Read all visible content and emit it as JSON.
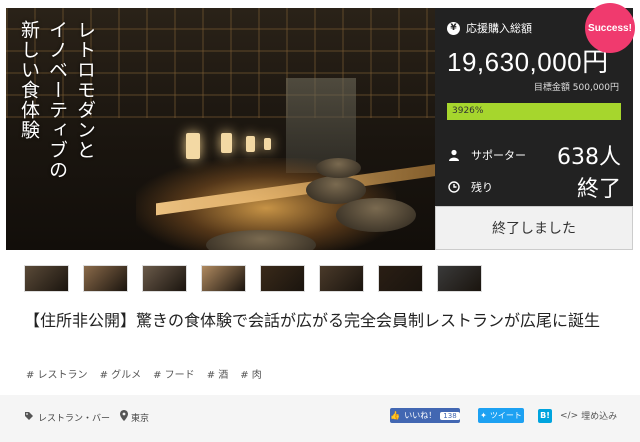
{
  "hero": {
    "tagline": [
      "レトロモダンと",
      "イノベーティブの",
      "新しい食体験"
    ]
  },
  "panel": {
    "yen_icon": "¥",
    "total_label": "応援購入総額",
    "total_value": "19,630,000円",
    "goal_label": "目標金額",
    "goal_value": "500,000円",
    "progress_text": "3926%",
    "progress_fraction": 1.0,
    "supporters_label": "サポーター",
    "supporters_value": "638人",
    "remaining_label": "残り",
    "remaining_value": "終了",
    "end_button": "終了しました",
    "badge": "Success!",
    "accent_color": "#a6d62d",
    "badge_color": "#f03a6e",
    "icons": [
      "yen-icon",
      "person-icon",
      "clock-icon"
    ]
  },
  "thumbnails": [
    {
      "label": "thumbnail-1",
      "color": "#5a4a38"
    },
    {
      "label": "thumbnail-2",
      "color": "#8a6a4a"
    },
    {
      "label": "thumbnail-3",
      "color": "#6a5a4a"
    },
    {
      "label": "thumbnail-4",
      "color": "#b08a60"
    },
    {
      "label": "thumbnail-5",
      "color": "#3a2a1a"
    },
    {
      "label": "thumbnail-6",
      "color": "#4a3a2a"
    },
    {
      "label": "thumbnail-7",
      "color": "#2a1e14"
    },
    {
      "label": "thumbnail-8",
      "color": "#3a3a3a"
    }
  ],
  "title": "【住所非公開】驚きの食体験で会話が広がる完全会員制レストランが広尾に誕生",
  "tags": [
    "# レストラン",
    "# グルメ",
    "# フード",
    "# 酒",
    "# 肉"
  ],
  "footer": {
    "category": "レストラン・バー",
    "location": "東京",
    "like_label": "いいね！",
    "like_count": "138",
    "tweet_label": "ツイート",
    "hatena_label": "B!",
    "embed_label": "埋め込み",
    "icons": [
      "tag-icon",
      "location-pin-icon",
      "thumbs-up-icon",
      "twitter-bird-icon",
      "code-icon"
    ]
  }
}
